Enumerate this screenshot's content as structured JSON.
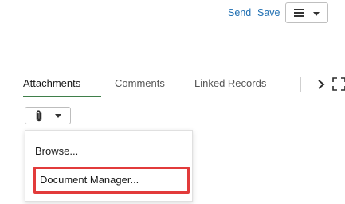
{
  "header": {
    "send_label": "Send",
    "save_label": "Save"
  },
  "tabs": [
    {
      "label": "Attachments",
      "active": true
    },
    {
      "label": "Comments",
      "active": false
    },
    {
      "label": "Linked Records",
      "active": false
    }
  ],
  "attach_menu": {
    "items": [
      {
        "label": "Browse..."
      },
      {
        "label": "Document Manager..."
      }
    ],
    "highlighted_item": "Document Manager..."
  },
  "colors": {
    "link": "#1f6fb2",
    "active_tab_underline": "#3f7f4a",
    "highlight_border": "#e23b3b"
  },
  "icons": {
    "menu": "hamburger-icon",
    "caret": "caret-down-icon",
    "next": "chevron-right-icon",
    "expand": "expand-icon",
    "attachment": "paperclip-icon"
  }
}
